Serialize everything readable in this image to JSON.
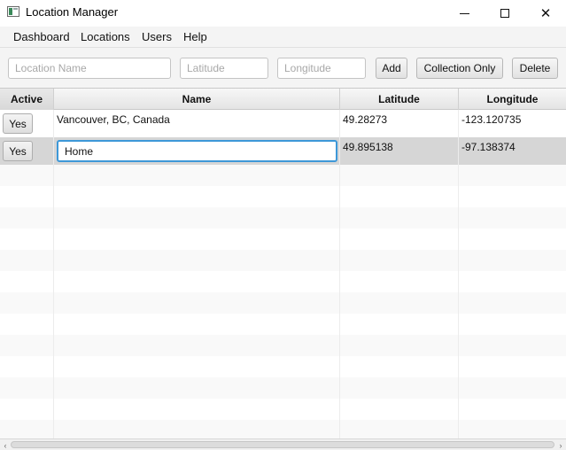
{
  "window": {
    "title": "Location Manager",
    "icon": "app-window-icon",
    "controls": {
      "minimize": "minimize-icon",
      "maximize": "maximize-icon",
      "close": "✕"
    }
  },
  "menu": [
    "Dashboard",
    "Locations",
    "Users",
    "Help"
  ],
  "toolbar": {
    "name_placeholder": "Location Name",
    "name_value": "",
    "lat_placeholder": "Latitude",
    "lat_value": "",
    "lon_placeholder": "Longitude",
    "lon_value": "",
    "add_label": "Add",
    "collection_label": "Collection Only",
    "delete_label": "Delete"
  },
  "table": {
    "columns": [
      "Active",
      "Name",
      "Latitude",
      "Longitude"
    ],
    "rows": [
      {
        "active": "Yes",
        "name": "Vancouver, BC, Canada",
        "latitude": "49.28273",
        "longitude": "-123.120735"
      },
      {
        "active": "Yes",
        "name": "Home",
        "latitude": "49.895138",
        "longitude": "-97.138374"
      }
    ],
    "selected_row": 1,
    "editing": {
      "row": 1,
      "column": "name"
    }
  },
  "scrollbar": {
    "left_arrow": "‹",
    "right_arrow": "›"
  },
  "colors": {
    "edit_focus": "#3d98d8",
    "selected_row": "#d6d6d6"
  }
}
